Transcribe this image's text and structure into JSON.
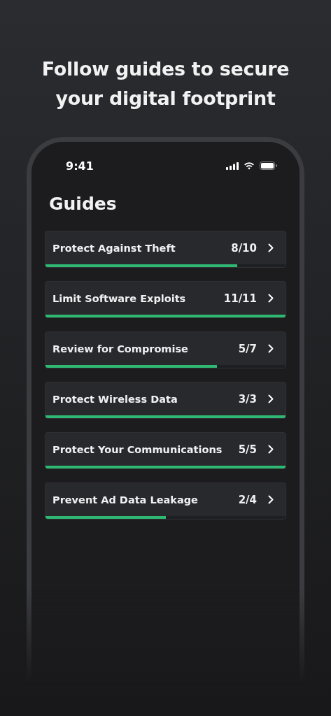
{
  "headline": "Follow guides to secure your digital footprint",
  "status_bar": {
    "time": "9:41"
  },
  "title": "Guides",
  "guides": [
    {
      "name": "Protect Against Theft",
      "count": "8/10",
      "level": 0.8
    },
    {
      "name": "Limit Software Exploits",
      "count": "11/11",
      "level": 1
    },
    {
      "name": "Review for Compromise",
      "count": "5/7",
      "level": 0.714
    },
    {
      "name": "Protect Wireless Data",
      "count": "3/3",
      "level": 1
    },
    {
      "name": "Protect Your Communications",
      "count": "5/5",
      "level": 1
    },
    {
      "name": "Prevent Ad Data Leakage",
      "count": "2/4",
      "level": 0.5
    }
  ]
}
